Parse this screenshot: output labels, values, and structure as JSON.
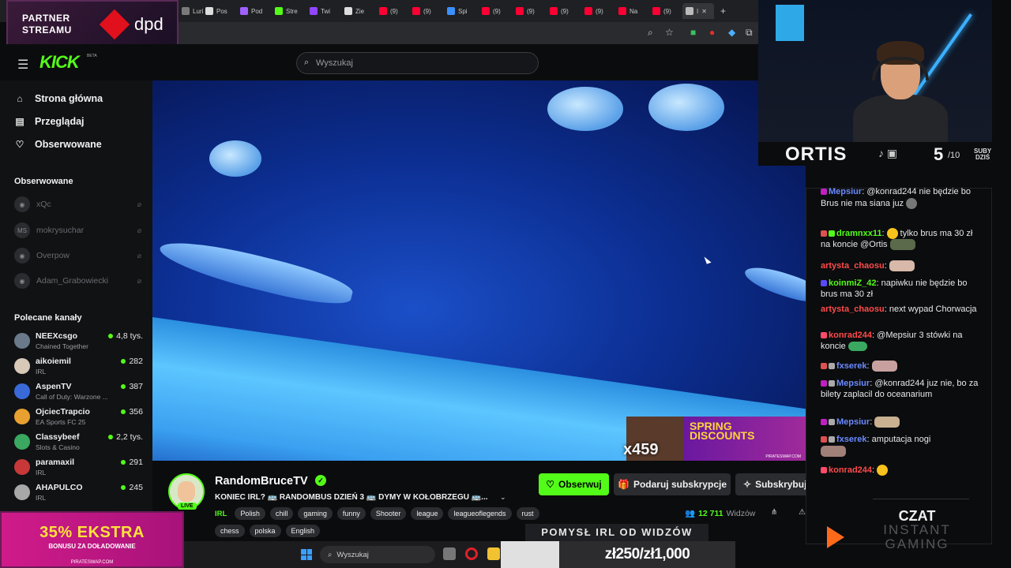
{
  "browser": {
    "tabs": [
      {
        "label": "Luri",
        "color": "#7a7a7a"
      },
      {
        "label": "Pos",
        "color": "#ffffff"
      },
      {
        "label": "Pod",
        "color": "#a060ff"
      },
      {
        "label": "Stre",
        "color": "#53fc18"
      },
      {
        "label": "Twi",
        "color": "#9146ff"
      },
      {
        "label": "Zie",
        "color": "#ffffff"
      },
      {
        "label": "(9)",
        "color": "#ff0033"
      },
      {
        "label": "(9)",
        "color": "#ff0033"
      },
      {
        "label": "Spi",
        "color": "#3b8fff"
      },
      {
        "label": "(9)",
        "color": "#ff0033"
      },
      {
        "label": "(9)",
        "color": "#ff0033"
      },
      {
        "label": "(9)",
        "color": "#ff0033"
      },
      {
        "label": "(9)",
        "color": "#ff0033"
      },
      {
        "label": "Na",
        "color": "#ff0033"
      },
      {
        "label": "(9)",
        "color": "#ff0033"
      },
      {
        "label": "I",
        "color": "#bbbbbb"
      }
    ]
  },
  "partner": {
    "line1": "PARTNER",
    "line2": "STREAMU",
    "brand": "dpd"
  },
  "header": {
    "logo": "KICK",
    "beta": "BETA",
    "search_placeholder": "Wyszukaj"
  },
  "sidebar": {
    "nav": [
      {
        "label": "Strona główna",
        "icon": "home-icon"
      },
      {
        "label": "Przeglądaj",
        "icon": "browse-icon"
      },
      {
        "label": "Obserwowane",
        "icon": "heart-icon"
      }
    ],
    "followed_title": "Obserwowane",
    "followed": [
      {
        "name": "xQc",
        "initials": ""
      },
      {
        "name": "mokrysuchar",
        "initials": "MS"
      },
      {
        "name": "Overpow",
        "initials": ""
      },
      {
        "name": "Adam_Grabowiecki",
        "initials": ""
      }
    ],
    "recommended_title": "Polecane kanały",
    "recommended": [
      {
        "name": "NEEXcsgo",
        "category": "Chained Together",
        "viewers": "4,8 tys.",
        "color": "#6a7a8a"
      },
      {
        "name": "aikoiemil",
        "category": "IRL",
        "viewers": "282",
        "color": "#d8c8b8"
      },
      {
        "name": "AspenTV",
        "category": "Call of Duty: Warzone ...",
        "viewers": "387",
        "color": "#3a6ad8"
      },
      {
        "name": "OjciecTrapcio",
        "category": "EA Sports FC 25",
        "viewers": "356",
        "color": "#e8a030"
      },
      {
        "name": "Classybeef",
        "category": "Slots & Casino",
        "viewers": "2,2 tys.",
        "color": "#3aa860"
      },
      {
        "name": "paramaxil",
        "category": "IRL",
        "viewers": "291",
        "color": "#c83838"
      },
      {
        "name": "AHAPULCO",
        "category": "IRL",
        "viewers": "245",
        "color": "#a8a8a8"
      }
    ]
  },
  "promo": {
    "headline": "35% EKSTRA",
    "sub": "BONUSU ZA DOŁADOWANIE",
    "site": "PIRATESWAP.COM"
  },
  "video": {
    "alert_count": "x459",
    "ad_line1": "SPRING",
    "ad_line2": "DISCOUNTS",
    "ad_site": "PIRATESWAP.COM"
  },
  "stream": {
    "streamer": "RandomBruceTV",
    "live": "LIVE",
    "title": "KONIEC IRL? 🚌 RANDOMBUS DZIEŃ 3 🚌 DYMY W KOŁOBRZEGU 🚌...",
    "category": "IRL",
    "tags": [
      "Polish",
      "chill",
      "gaming",
      "funny",
      "Shooter",
      "league",
      "leagueoflegends",
      "rust",
      "chess",
      "polska",
      "English"
    ],
    "follow_label": "Obserwuj",
    "gift_label": "Podaruj subskrypcje",
    "sub_label": "Subskrybuj",
    "viewers": "12 711",
    "viewers_label": "Widzów"
  },
  "poll": {
    "label": "POMYSŁ IRL OD WIDZÓW"
  },
  "goal": {
    "label": "zł250/zł1,000",
    "progress": 0.25
  },
  "taskbar": {
    "search_label": "Wyszukaj"
  },
  "overlay": {
    "name": "ORTIS",
    "subs_today": "5",
    "subs_goal": "/10",
    "subs_label_1": "SUBY",
    "subs_label_2": "DZIŚ"
  },
  "chat": {
    "messages": [
      {
        "user": "Mepsiur",
        "color": "#6a8aff",
        "text": "@konrad244 nie będzie bo Brus nie ma siana juz",
        "emote": true
      },
      {
        "user": "dramnxx11",
        "color": "#53fc18",
        "text": "tylko brus ma 30 zł na koncie @Ortis",
        "emote": true
      },
      {
        "user": "artysta_chaosu",
        "color": "#ff4a4a",
        "text": "",
        "emote": true
      },
      {
        "user": "koinmiZ_42",
        "color": "#53fc18",
        "text": "napiwku nie będzie bo brus ma 30 zł",
        "emote": false
      },
      {
        "user": "artysta_chaosu",
        "color": "#ff4a4a",
        "text": "next wypad Chorwacja",
        "emote": false
      },
      {
        "user": "konrad244",
        "color": "#ff4a4a",
        "text": "@Mepsiur 3 stówki na koncie",
        "emote": true
      },
      {
        "user": "fxserek",
        "color": "#6a8aff",
        "text": "",
        "emote": true
      },
      {
        "user": "Mepsiur",
        "color": "#6a8aff",
        "text": "@konrad244 juz nie, bo za bilety zaplacil do oceanarium",
        "emote": false
      },
      {
        "user": "Mepsiur",
        "color": "#6a8aff",
        "text": "",
        "emote": true
      },
      {
        "user": "fxserek",
        "color": "#6a8aff",
        "text": "amputacja nogi",
        "emote": true
      },
      {
        "user": "konrad244",
        "color": "#ff4a4a",
        "text": "",
        "emote": true
      }
    ],
    "panel_title": "CZAT",
    "panel_sub": "INSTANT GAMING"
  }
}
